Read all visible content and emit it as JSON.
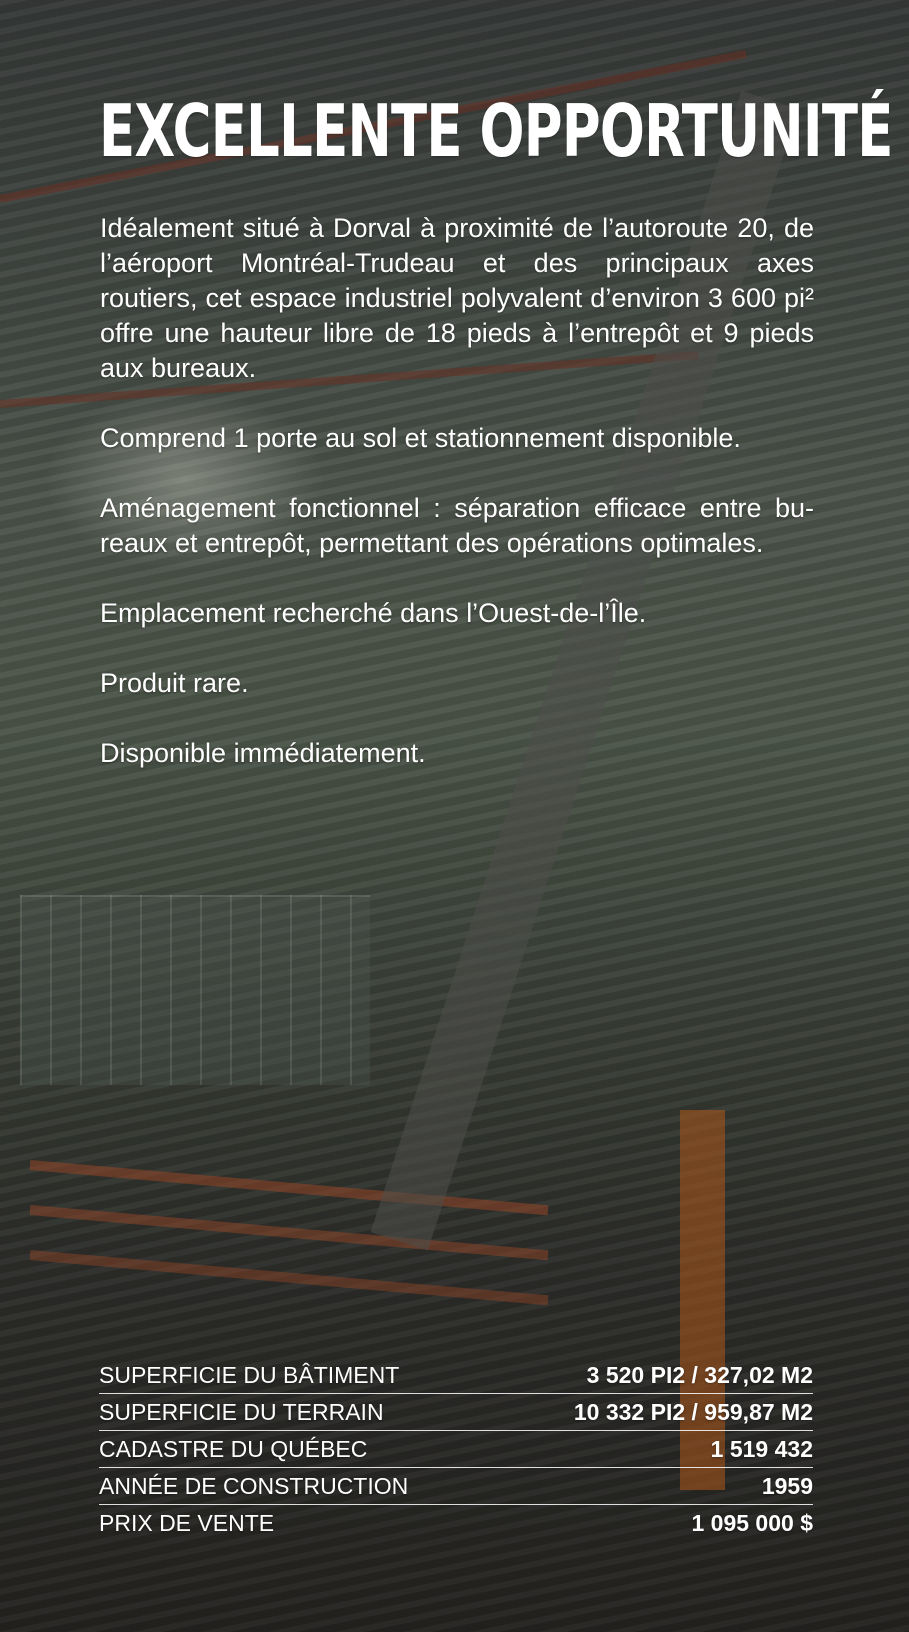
{
  "title": "EXCELLENTE OPPORTUNITÉ",
  "description": [
    "Idéalement situé à Dorval à proximité de l’autoroute 20, de l’aéroport Montréal-Trudeau et des principaux axes routiers, cet espace industriel polyvalent d’environ 3 600 pi² offre une hauteur libre de 18 pieds à l’entrepôt et 9 pieds aux bureaux.",
    "Comprend 1 porte au sol et stationnement disponible.",
    "Aménagement fonctionnel : séparation efficace entre bu-reaux et entrepôt, permettant des opérations optimales.",
    "Emplacement recherché dans l’Ouest-de-l’Île.",
    "Produit rare.",
    "Disponible immédiatement."
  ],
  "specs": [
    {
      "label": "SUPERFICIE DU BÂTIMENT",
      "value": "3 520 PI2 / 327,02 M2"
    },
    {
      "label": "SUPERFICIE DU TERRAIN",
      "value": "10 332 PI2 / 959,87 M2"
    },
    {
      "label": "CADASTRE DU QUÉBEC",
      "value": "1 519 432"
    },
    {
      "label": "ANNÉE DE CONSTRUCTION",
      "value": "1959"
    },
    {
      "label": "PRIX DE VENTE",
      "value": "1 095 000 $"
    }
  ]
}
